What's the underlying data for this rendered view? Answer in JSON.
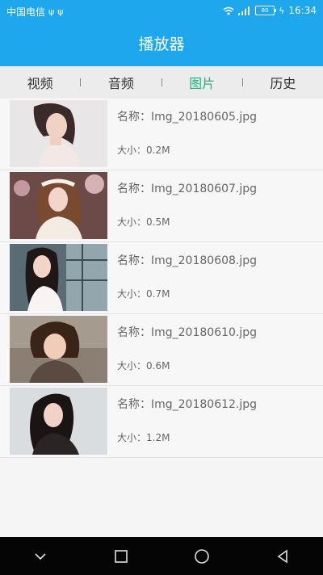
{
  "status_bar": {
    "carrier": "中国电信",
    "usb_icons": [
      "usb-icon",
      "usb-icon"
    ],
    "battery": "80",
    "time": "16:34"
  },
  "app_bar": {
    "title": "播放器"
  },
  "tabs": [
    {
      "label": "视频",
      "active": false
    },
    {
      "label": "音频",
      "active": false
    },
    {
      "label": "图片",
      "active": true
    },
    {
      "label": "历史",
      "active": false
    }
  ],
  "items": [
    {
      "name": "名称：Img_20180605.jpg",
      "size": "大小：0.2M"
    },
    {
      "name": "名称：Img_20180607.jpg",
      "size": "大小：0.5M"
    },
    {
      "name": "名称：Img_20180608.jpg",
      "size": "大小：0.7M"
    },
    {
      "name": "名称：Img_20180610.jpg",
      "size": "大小：0.6M"
    },
    {
      "name": "名称：Img_20180612.jpg",
      "size": "大小：1.2M"
    }
  ],
  "colors": {
    "primary": "#1fa7ee",
    "active_tab": "#22b07d"
  },
  "nav_bar": [
    "chevron-down-icon",
    "square-icon",
    "circle-icon",
    "back-triangle-icon"
  ]
}
